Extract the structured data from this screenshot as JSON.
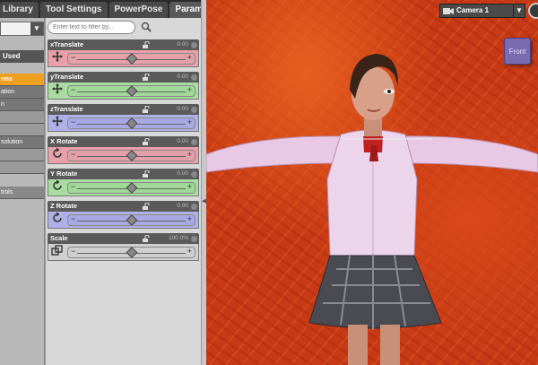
{
  "tabs": [
    {
      "label": "Library",
      "active": false
    },
    {
      "label": "Tool Settings",
      "active": false
    },
    {
      "label": "PowerPose",
      "active": false
    },
    {
      "label": "Parameters",
      "active": true
    }
  ],
  "left_panel": {
    "used_label": "Used",
    "rows": [
      {
        "label": "rms",
        "selected": true
      },
      {
        "label": "ation",
        "selected": false
      },
      {
        "label": "n",
        "selected": false
      },
      {
        "label": "",
        "selected": false
      },
      {
        "label": "",
        "selected": false
      },
      {
        "label": "solution",
        "selected": false
      },
      {
        "label": "",
        "selected": false
      },
      {
        "label": "",
        "selected": false
      }
    ],
    "controls_label": "trols"
  },
  "filter": {
    "placeholder": "Enter text to filter by..."
  },
  "parameters": [
    {
      "name": "xTranslate",
      "value": "0.00",
      "color": "red",
      "icon": "move-icon",
      "level": 0.5
    },
    {
      "name": "yTranslate",
      "value": "0.00",
      "color": "green",
      "icon": "move-icon",
      "level": 0.5
    },
    {
      "name": "zTranslate",
      "value": "0.00",
      "color": "blue",
      "icon": "move-icon",
      "level": 0.5
    },
    {
      "name": "X Rotate",
      "value": "0.00",
      "color": "red",
      "icon": "rotate-icon",
      "level": 0.5
    },
    {
      "name": "Y Rotate",
      "value": "0.00",
      "color": "green",
      "icon": "rotate-icon",
      "level": 0.5
    },
    {
      "name": "Z Rotate",
      "value": "0.00",
      "color": "blue",
      "icon": "rotate-icon",
      "level": 0.5
    },
    {
      "name": "Scale",
      "value": "100.0%",
      "color": "gray",
      "icon": "scale-icon",
      "level": 0.5
    }
  ],
  "viewport": {
    "camera_label": "Camera 1",
    "cube_label": "Front"
  },
  "colors": {
    "accent": "#f0a020",
    "background": "#c83a15"
  }
}
